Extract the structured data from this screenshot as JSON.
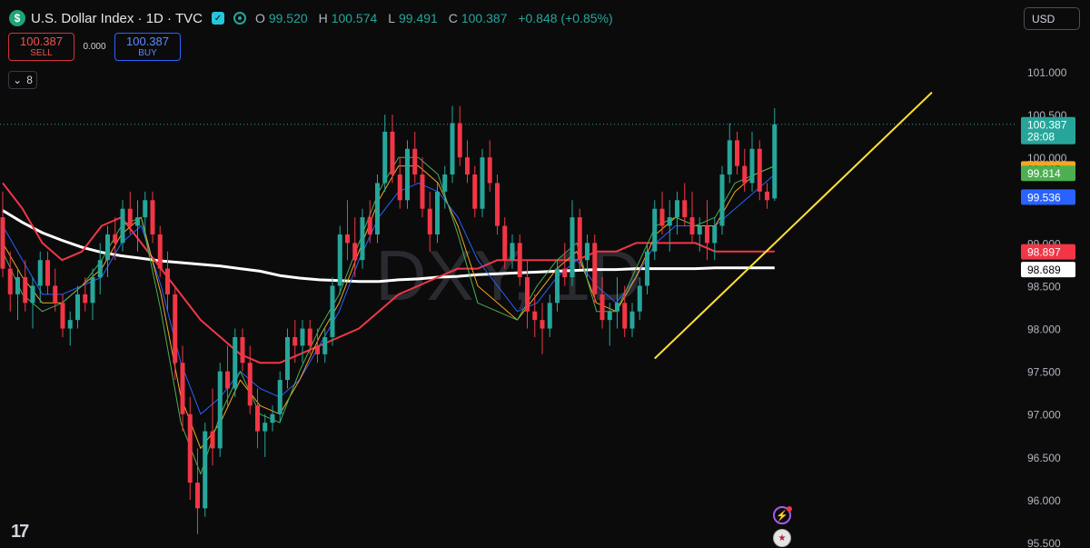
{
  "header": {
    "logo_glyph": "$",
    "title": "U.S. Dollar Index · 1D · TVC",
    "ohlc": {
      "o_key": "O",
      "o": "99.520",
      "h_key": "H",
      "h": "100.574",
      "l_key": "L",
      "l": "99.491",
      "c_key": "C",
      "c": "100.387",
      "chg": "+0.848 (+0.85%)"
    }
  },
  "trade": {
    "sell_price": "100.387",
    "sell_label": "SELL",
    "spread": "0.000",
    "buy_price": "100.387",
    "buy_label": "BUY"
  },
  "indicators": {
    "count": "8"
  },
  "currency": {
    "value": "USD"
  },
  "watermark": "DXY, 1D",
  "colors": {
    "up": "#26a69a",
    "down": "#f23645",
    "sma200": "#ffffff",
    "ma50": "#f23645",
    "ma20": "#2962ff",
    "ma10": "#f5a623",
    "ma5": "#4caf50",
    "trendline": "#ffe033"
  },
  "chart_data": {
    "type": "candlestick",
    "title": "U.S. Dollar Index · 1D · TVC",
    "ylim": [
      95.5,
      101.4
    ],
    "y_ticks": [
      "101.000",
      "100.500",
      "100.000",
      "99.500",
      "99.000",
      "98.500",
      "98.000",
      "97.500",
      "97.000",
      "96.500",
      "96.000",
      "95.500"
    ],
    "y_tick_values": [
      101.0,
      100.5,
      100.0,
      99.5,
      99.0,
      98.5,
      98.0,
      97.5,
      97.0,
      96.5,
      96.0,
      95.5
    ],
    "candles": [
      [
        99.3,
        99.6,
        98.6,
        98.7
      ],
      [
        98.7,
        98.9,
        98.2,
        98.4
      ],
      [
        98.4,
        98.7,
        98.1,
        98.6
      ],
      [
        98.6,
        98.8,
        98.2,
        98.3
      ],
      [
        98.3,
        98.6,
        98.0,
        98.5
      ],
      [
        98.5,
        98.9,
        98.3,
        98.8
      ],
      [
        98.8,
        98.9,
        98.4,
        98.5
      ],
      [
        98.5,
        98.7,
        98.2,
        98.3
      ],
      [
        98.3,
        98.4,
        97.9,
        98.0
      ],
      [
        98.0,
        98.2,
        97.8,
        98.1
      ],
      [
        98.1,
        98.5,
        98.0,
        98.4
      ],
      [
        98.4,
        98.6,
        98.2,
        98.3
      ],
      [
        98.3,
        98.7,
        98.1,
        98.6
      ],
      [
        98.6,
        99.0,
        98.4,
        98.8
      ],
      [
        98.8,
        99.2,
        98.6,
        99.1
      ],
      [
        99.1,
        99.3,
        98.8,
        99.0
      ],
      [
        99.0,
        99.5,
        98.9,
        99.4
      ],
      [
        99.4,
        99.6,
        99.1,
        99.2
      ],
      [
        99.2,
        99.5,
        98.9,
        99.3
      ],
      [
        99.3,
        99.6,
        99.1,
        99.5
      ],
      [
        99.5,
        99.6,
        99.0,
        99.1
      ],
      [
        99.1,
        99.2,
        98.6,
        98.7
      ],
      [
        98.7,
        98.9,
        98.2,
        98.4
      ],
      [
        98.4,
        98.5,
        97.4,
        97.6
      ],
      [
        97.6,
        97.8,
        96.8,
        97.0
      ],
      [
        97.0,
        97.2,
        96.0,
        96.2
      ],
      [
        96.2,
        96.6,
        95.6,
        95.9
      ],
      [
        95.9,
        96.9,
        95.8,
        96.8
      ],
      [
        96.8,
        97.3,
        96.4,
        96.6
      ],
      [
        96.6,
        97.6,
        96.5,
        97.5
      ],
      [
        97.5,
        97.8,
        97.1,
        97.3
      ],
      [
        97.3,
        98.0,
        97.2,
        97.9
      ],
      [
        97.9,
        98.0,
        97.5,
        97.6
      ],
      [
        97.6,
        97.8,
        97.0,
        97.1
      ],
      [
        97.1,
        97.3,
        96.6,
        96.8
      ],
      [
        96.8,
        97.0,
        96.5,
        96.9
      ],
      [
        96.9,
        97.1,
        96.8,
        97.0
      ],
      [
        97.0,
        97.5,
        96.9,
        97.4
      ],
      [
        97.4,
        98.0,
        97.3,
        97.9
      ],
      [
        97.9,
        98.1,
        97.6,
        97.8
      ],
      [
        97.8,
        98.1,
        97.6,
        98.0
      ],
      [
        98.0,
        98.1,
        97.7,
        97.8
      ],
      [
        97.8,
        98.0,
        97.6,
        97.7
      ],
      [
        97.7,
        98.0,
        97.6,
        97.9
      ],
      [
        97.9,
        98.6,
        97.8,
        98.5
      ],
      [
        98.5,
        99.2,
        98.4,
        99.1
      ],
      [
        99.1,
        99.5,
        98.8,
        99.0
      ],
      [
        99.0,
        99.3,
        98.6,
        98.8
      ],
      [
        98.8,
        99.4,
        98.7,
        99.3
      ],
      [
        99.3,
        99.5,
        99.0,
        99.1
      ],
      [
        99.1,
        99.8,
        99.0,
        99.7
      ],
      [
        99.7,
        100.5,
        99.6,
        100.3
      ],
      [
        100.3,
        100.5,
        99.7,
        99.8
      ],
      [
        99.8,
        100.0,
        99.4,
        99.5
      ],
      [
        99.5,
        100.2,
        99.4,
        100.1
      ],
      [
        100.1,
        100.3,
        99.7,
        99.8
      ],
      [
        99.8,
        100.0,
        99.3,
        99.4
      ],
      [
        99.4,
        99.6,
        98.9,
        99.1
      ],
      [
        99.1,
        99.7,
        99.0,
        99.6
      ],
      [
        99.6,
        99.9,
        99.4,
        99.8
      ],
      [
        99.8,
        100.6,
        99.7,
        100.4
      ],
      [
        100.4,
        100.6,
        99.9,
        100.0
      ],
      [
        100.0,
        100.2,
        99.7,
        99.8
      ],
      [
        99.8,
        99.9,
        99.3,
        99.4
      ],
      [
        99.4,
        100.1,
        99.3,
        100.0
      ],
      [
        100.0,
        100.2,
        99.6,
        99.7
      ],
      [
        99.7,
        99.8,
        99.1,
        99.2
      ],
      [
        99.2,
        99.3,
        98.7,
        98.8
      ],
      [
        98.8,
        99.1,
        98.7,
        99.0
      ],
      [
        99.0,
        99.1,
        98.5,
        98.6
      ],
      [
        98.6,
        98.8,
        98.0,
        98.2
      ],
      [
        98.2,
        98.4,
        97.9,
        98.1
      ],
      [
        98.1,
        98.3,
        97.7,
        98.0
      ],
      [
        98.0,
        98.4,
        97.9,
        98.3
      ],
      [
        98.3,
        98.8,
        98.2,
        98.7
      ],
      [
        98.7,
        99.0,
        98.5,
        98.6
      ],
      [
        98.6,
        99.5,
        98.5,
        99.3
      ],
      [
        99.3,
        99.4,
        98.7,
        98.8
      ],
      [
        98.8,
        99.1,
        98.6,
        99.0
      ],
      [
        99.0,
        99.1,
        98.3,
        98.4
      ],
      [
        98.4,
        98.6,
        98.0,
        98.1
      ],
      [
        98.1,
        98.3,
        97.8,
        98.2
      ],
      [
        98.2,
        98.6,
        98.0,
        98.3
      ],
      [
        98.3,
        98.5,
        97.9,
        98.0
      ],
      [
        98.0,
        98.3,
        97.9,
        98.2
      ],
      [
        98.2,
        98.6,
        98.1,
        98.5
      ],
      [
        98.5,
        99.0,
        98.4,
        98.9
      ],
      [
        98.9,
        99.5,
        98.8,
        99.4
      ],
      [
        99.4,
        99.6,
        99.1,
        99.2
      ],
      [
        99.2,
        99.5,
        98.9,
        99.3
      ],
      [
        99.3,
        99.6,
        99.1,
        99.5
      ],
      [
        99.5,
        99.7,
        99.2,
        99.3
      ],
      [
        99.3,
        99.6,
        99.0,
        99.1
      ],
      [
        99.1,
        99.3,
        98.9,
        99.2
      ],
      [
        99.2,
        99.5,
        98.8,
        99.0
      ],
      [
        99.0,
        99.3,
        98.8,
        99.2
      ],
      [
        99.2,
        99.9,
        99.1,
        99.8
      ],
      [
        99.8,
        100.4,
        99.7,
        100.2
      ],
      [
        100.2,
        100.3,
        99.8,
        99.9
      ],
      [
        99.9,
        100.1,
        99.6,
        99.7
      ],
      [
        99.7,
        100.3,
        99.6,
        100.1
      ],
      [
        100.1,
        100.2,
        99.5,
        99.6
      ],
      [
        99.6,
        99.7,
        99.4,
        99.5
      ],
      [
        99.52,
        100.574,
        99.491,
        100.387
      ]
    ],
    "series": [
      {
        "name": "",
        "color": "#ffffff",
        "width": 3,
        "values": [
          99.38,
          99.24,
          99.12,
          99.03,
          98.95,
          98.89,
          98.85,
          98.82,
          98.79,
          98.77,
          98.75,
          98.73,
          98.7,
          98.67,
          98.62,
          98.59,
          98.57,
          98.56,
          98.55,
          98.55,
          98.57,
          98.58,
          98.6,
          98.61,
          98.63,
          98.64,
          98.65,
          98.66,
          98.67,
          98.68,
          98.69,
          98.69,
          98.7,
          98.7,
          98.7,
          98.7,
          98.71,
          98.71,
          98.71,
          98.71
        ]
      },
      {
        "name": "",
        "color": "#f23645",
        "width": 2,
        "values": [
          99.7,
          99.4,
          99.0,
          98.8,
          98.9,
          99.2,
          99.3,
          99.0,
          98.7,
          98.4,
          98.1,
          97.9,
          97.7,
          97.6,
          97.6,
          97.7,
          97.8,
          97.9,
          98.0,
          98.2,
          98.4,
          98.5,
          98.6,
          98.7,
          98.7,
          98.8,
          98.8,
          98.8,
          98.8,
          98.8,
          98.9,
          98.9,
          99.0,
          99.0,
          99.0,
          99.0,
          98.9,
          98.9,
          98.9,
          98.9
        ]
      },
      {
        "name": "",
        "color": "#2962ff",
        "width": 1,
        "values": [
          99.2,
          98.8,
          98.4,
          98.4,
          98.5,
          98.6,
          99.0,
          99.2,
          98.5,
          97.6,
          97.0,
          97.2,
          97.5,
          97.3,
          97.2,
          97.4,
          97.8,
          98.2,
          98.8,
          99.3,
          99.6,
          99.7,
          99.6,
          99.3,
          98.8,
          98.5,
          98.2,
          98.3,
          98.6,
          98.8,
          98.5,
          98.3,
          98.6,
          99.0,
          99.2,
          99.2,
          99.2,
          99.4,
          99.6,
          99.8
        ]
      },
      {
        "name": "",
        "color": "#f5a623",
        "width": 1,
        "values": [
          99.0,
          98.6,
          98.3,
          98.3,
          98.5,
          98.7,
          99.1,
          99.3,
          98.4,
          97.2,
          96.6,
          96.9,
          97.4,
          97.1,
          97.0,
          97.4,
          97.9,
          98.3,
          98.9,
          99.5,
          99.9,
          99.9,
          99.7,
          99.2,
          98.5,
          98.3,
          98.1,
          98.4,
          98.7,
          98.9,
          98.3,
          98.2,
          98.6,
          99.1,
          99.3,
          99.2,
          99.2,
          99.6,
          99.8,
          99.9
        ]
      },
      {
        "name": "",
        "color": "#4caf50",
        "width": 1,
        "values": [
          98.9,
          98.4,
          98.2,
          98.3,
          98.5,
          98.8,
          99.2,
          99.3,
          98.2,
          96.9,
          96.3,
          97.0,
          97.5,
          97.0,
          96.9,
          97.5,
          98.0,
          98.4,
          99.0,
          99.6,
          100.0,
          100.0,
          99.8,
          99.1,
          98.3,
          98.2,
          98.1,
          98.5,
          98.8,
          99.0,
          98.2,
          98.2,
          98.7,
          99.2,
          99.3,
          99.2,
          99.3,
          99.7,
          99.8,
          99.9
        ]
      }
    ],
    "trendline": [
      [
        87,
        97.65
      ],
      [
        124,
        100.76
      ]
    ],
    "price_labels": [
      {
        "value": "100.387",
        "sub": "28:08",
        "bg": "#26a69a",
        "fg": "#ffffff",
        "y": 100.387
      },
      {
        "value": "99.865",
        "bg": "#f5a623",
        "fg": "#000000",
        "y": 99.865
      },
      {
        "value": "99.814",
        "bg": "#4caf50",
        "fg": "#ffffff",
        "y": 99.814
      },
      {
        "value": "99.536",
        "bg": "#2962ff",
        "fg": "#ffffff",
        "y": 99.536
      },
      {
        "value": "98.897",
        "bg": "#f23645",
        "fg": "#ffffff",
        "y": 98.897
      },
      {
        "value": "98.689",
        "bg": "#ffffff",
        "fg": "#000000",
        "y": 98.689
      }
    ]
  }
}
